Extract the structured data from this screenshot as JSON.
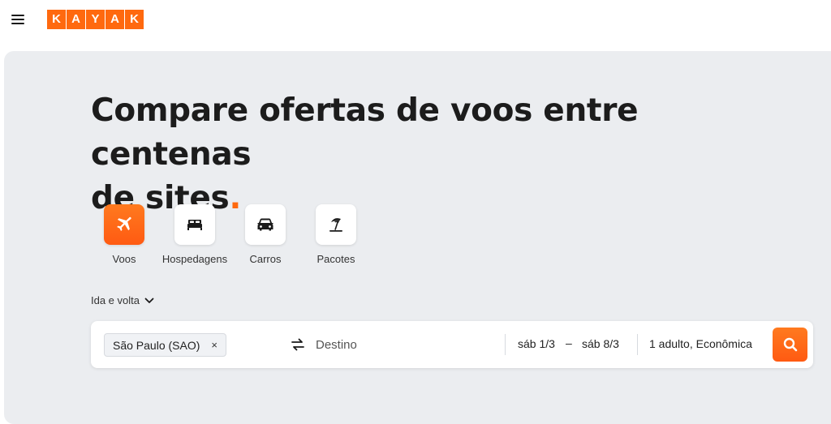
{
  "brand": {
    "letters": [
      "K",
      "A",
      "Y",
      "A",
      "K"
    ],
    "color": "#ff690f"
  },
  "hero": {
    "headline_line1": "Compare ofertas de voos entre centenas",
    "headline_line2": "de sites",
    "headline_dot": "."
  },
  "verticals": [
    {
      "label": "Voos",
      "icon": "plane-icon",
      "active": true
    },
    {
      "label": "Hospedagens",
      "icon": "bed-icon",
      "active": false
    },
    {
      "label": "Carros",
      "icon": "car-icon",
      "active": false
    },
    {
      "label": "Pacotes",
      "icon": "beach-umbrella-icon",
      "active": false
    }
  ],
  "trip_type": {
    "label": "Ida e volta"
  },
  "search": {
    "origin": "São Paulo (SAO)",
    "origin_remove": "×",
    "destination_placeholder": "Destino",
    "depart_date": "sáb 1/3",
    "date_separator": "–",
    "return_date": "sáb 8/3",
    "travelers": "1 adulto, Econômica"
  },
  "colors": {
    "accent": "#ff690f",
    "hero_bg": "#ebedf0"
  }
}
